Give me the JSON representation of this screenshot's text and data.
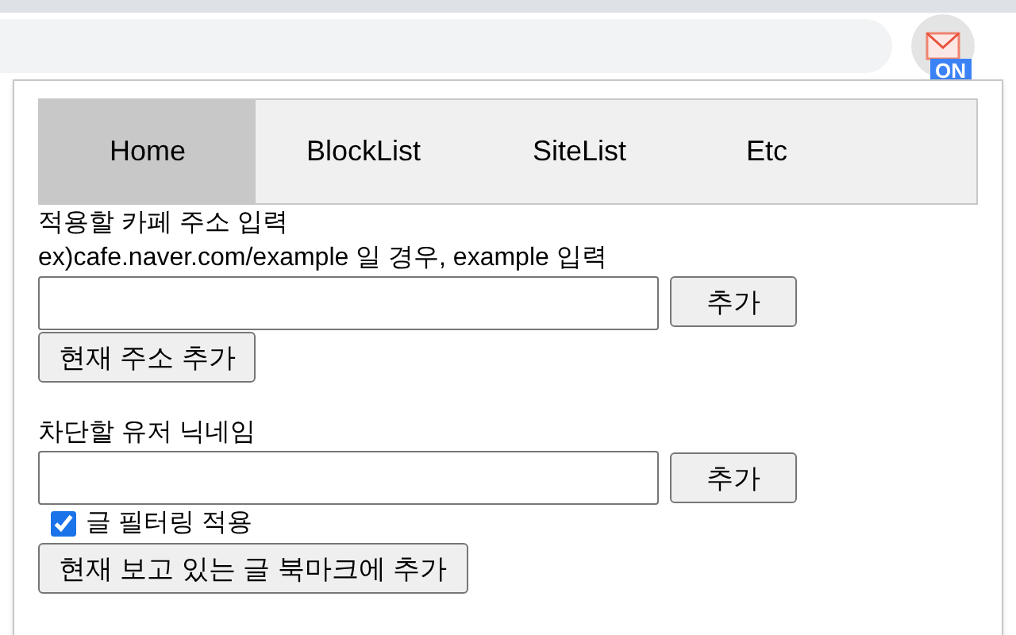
{
  "extension": {
    "badge": "ON"
  },
  "tabs": [
    {
      "label": "Home",
      "selected": true
    },
    {
      "label": "BlockList",
      "selected": false
    },
    {
      "label": "SiteList",
      "selected": false
    },
    {
      "label": "Etc",
      "selected": false
    }
  ],
  "cafe_section": {
    "label": "적용할 카페 주소 입력",
    "hint": "ex)cafe.naver.com/example 일 경우, example 입력",
    "add_button": "추가",
    "current_button": "현재 주소 추가"
  },
  "user_section": {
    "label": "차단할 유저 닉네임",
    "add_button": "추가"
  },
  "filter": {
    "label": "글 필터링 적용",
    "checked": true
  },
  "bookmark_button": "현재 보고 있는 글 북마크에 추가"
}
